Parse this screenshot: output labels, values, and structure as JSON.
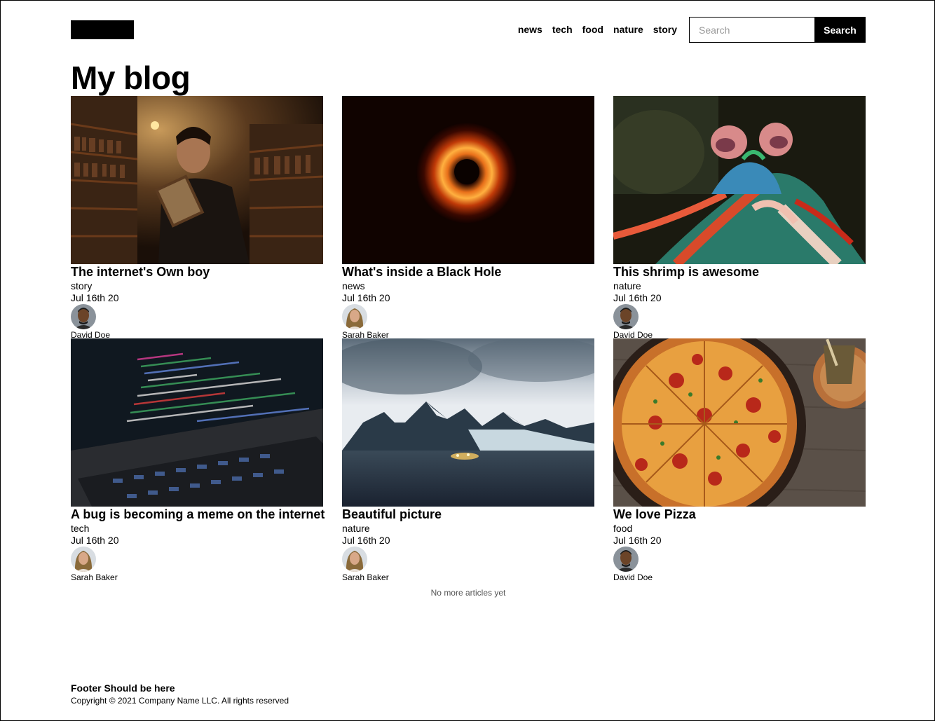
{
  "header": {
    "nav": [
      "news",
      "tech",
      "food",
      "nature",
      "story"
    ],
    "search_placeholder": "Search",
    "search_button": "Search"
  },
  "page_title": "My blog",
  "posts": [
    {
      "title": "The internet's Own boy",
      "category": "story",
      "date": "Jul 16th 20",
      "author": "David Doe",
      "image": "man-in-library-photo",
      "avatar": "man-avatar"
    },
    {
      "title": "What's inside a Black Hole",
      "category": "news",
      "date": "Jul 16th 20",
      "author": "Sarah Baker",
      "image": "black-hole-photo",
      "avatar": "woman-avatar"
    },
    {
      "title": "This shrimp is awesome",
      "category": "nature",
      "date": "Jul 16th 20",
      "author": "David Doe",
      "image": "mantis-shrimp-photo",
      "avatar": "man-avatar"
    },
    {
      "title": "A bug is becoming a meme on the internet",
      "category": "tech",
      "date": "Jul 16th 20",
      "author": "Sarah Baker",
      "image": "laptop-code-photo",
      "avatar": "woman-avatar"
    },
    {
      "title": "Beautiful picture",
      "category": "nature",
      "date": "Jul 16th 20",
      "author": "Sarah Baker",
      "image": "mountain-landscape-photo",
      "avatar": "woman-avatar"
    },
    {
      "title": "We love Pizza",
      "category": "food",
      "date": "Jul 16th 20",
      "author": "David Doe",
      "image": "pizza-photo",
      "avatar": "man-avatar"
    }
  ],
  "no_more": "No more articles yet",
  "footer": {
    "title": "Footer Should be here",
    "copyright": "Copyright © 2021 Company Name LLC. All rights reserved"
  }
}
